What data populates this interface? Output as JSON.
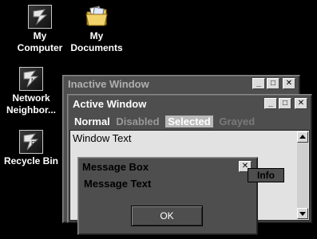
{
  "desktop": {
    "icons": [
      {
        "label_line1": "My",
        "label_line2": "Computer",
        "icon": "my-computer-icon"
      },
      {
        "label_line1": "My",
        "label_line2": "Documents",
        "icon": "folder-documents-icon"
      },
      {
        "label_line1": "Network",
        "label_line2": "Neighbor...",
        "icon": "network-neighborhood-icon"
      },
      {
        "label_line1": "Recycle Bin",
        "label_line2": "",
        "icon": "recycle-bin-icon"
      }
    ]
  },
  "inactive_window": {
    "title": "Inactive Window",
    "buttons": {
      "minimize": "_",
      "maximize": "□",
      "close": "✕"
    }
  },
  "active_window": {
    "title": "Active Window",
    "buttons": {
      "minimize": "_",
      "maximize": "□",
      "close": "✕"
    },
    "menu": {
      "normal": "Normal",
      "disabled": "Disabled",
      "selected": "Selected",
      "grayed": "Grayed"
    },
    "window_text": "Window Text"
  },
  "message_box": {
    "title": "Message Box",
    "close": "✕",
    "text": "Message Text",
    "ok_label": "OK"
  },
  "tooltip": {
    "text": "Info"
  },
  "colors": {
    "desktop": "#000000",
    "window_frame": "#4e4e4e",
    "client": "#e2e2e2",
    "inactive_title_text": "#b0b0b0",
    "active_title_text": "#ffffff",
    "selected_highlight": "#b9b9b9"
  }
}
